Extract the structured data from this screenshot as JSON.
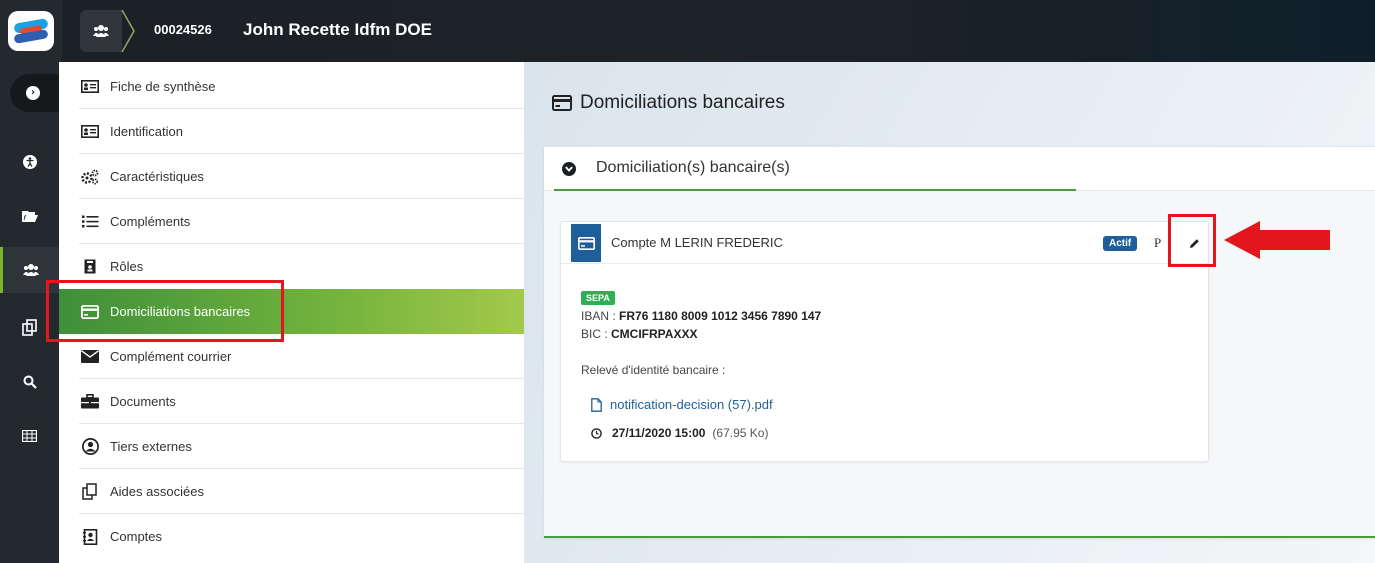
{
  "header": {
    "record_id": "00024526",
    "record_name": "John Recette Idfm DOE"
  },
  "rail": {
    "icons": [
      "chevron-right-icon",
      "accessibility-icon",
      "folder-icon",
      "users-icon",
      "copy-icon",
      "search-icon",
      "table-icon"
    ]
  },
  "menu": {
    "items": [
      {
        "label": "Fiche de synthèse",
        "icon": "id-card-icon"
      },
      {
        "label": "Identification",
        "icon": "id-card-icon"
      },
      {
        "label": "Caractéristiques",
        "icon": "gears-icon"
      },
      {
        "label": "Compléments",
        "icon": "list-icon"
      },
      {
        "label": "Rôles",
        "icon": "role-icon"
      },
      {
        "label": "Domiciliations bancaires",
        "icon": "credit-card-icon"
      },
      {
        "label": "Complément courrier",
        "icon": "envelope-icon"
      },
      {
        "label": "Documents",
        "icon": "briefcase-icon"
      },
      {
        "label": "Tiers externes",
        "icon": "user-circle-icon"
      },
      {
        "label": "Aides associées",
        "icon": "copy-icon"
      },
      {
        "label": "Comptes",
        "icon": "contact-book-icon"
      }
    ],
    "active_index": 5
  },
  "main": {
    "title": "Domiciliations bancaires",
    "panel_title": "Domiciliation(s) bancaire(s)",
    "account": {
      "title": "Compte M LERIN FREDERIC",
      "status": "Actif",
      "p_letter": "P",
      "type_badge": "SEPA",
      "iban_label": "IBAN :",
      "iban": "FR76 1180 8009 1012 3456 7890 147",
      "bic_label": "BIC :",
      "bic": "CMCIFRPAXXX",
      "rib_label": "Relevé d'identité bancaire :",
      "file_name": "notification-decision (57).pdf",
      "file_date": "27/11/2020 15:00",
      "file_size": "(67.95 Ko)"
    }
  },
  "colors": {
    "accent_green": "#4c9a3f",
    "brand_blue": "#1f5f99",
    "highlight_red": "#e3161c",
    "sepa_green": "#2fae53"
  }
}
